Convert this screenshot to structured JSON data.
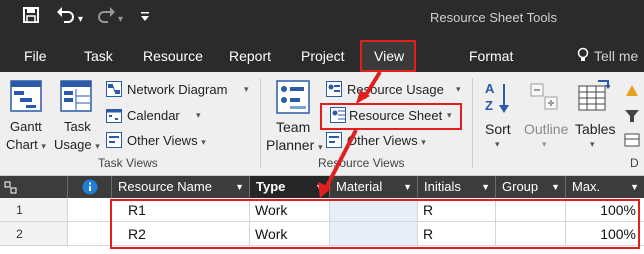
{
  "qat": {
    "save_icon": "save-icon",
    "undo_icon": "undo-icon",
    "redo_icon": "redo-icon",
    "customize_icon": "customize-icon"
  },
  "contextual_tab_label": "Resource Sheet Tools",
  "tabs": [
    {
      "label": "File"
    },
    {
      "label": "Task"
    },
    {
      "label": "Resource"
    },
    {
      "label": "Report"
    },
    {
      "label": "Project"
    },
    {
      "label": "View"
    },
    {
      "label": "Format"
    }
  ],
  "tell_me": "Tell me",
  "ribbon": {
    "task_views": {
      "gantt_l1": "Gantt",
      "gantt_l2": "Chart",
      "usage_l1": "Task",
      "usage_l2": "Usage",
      "network": "Network Diagram",
      "calendar": "Calendar",
      "other": "Other Views",
      "group_label": "Task Views"
    },
    "resource_views": {
      "team_l1": "Team",
      "team_l2": "Planner",
      "usage": "Resource Usage",
      "sheet": "Resource Sheet",
      "other": "Other Views",
      "group_label": "Resource Views"
    },
    "data": {
      "sort": "Sort",
      "outline": "Outline",
      "tables": "Tables",
      "group_label_partial": "D"
    }
  },
  "columns": [
    "Resource Name",
    "Type",
    "Material",
    "Initials",
    "Group",
    "Max."
  ],
  "rows": [
    {
      "num": "1",
      "name": "R1",
      "type": "Work",
      "material": "",
      "initials": "R",
      "group": "",
      "max": "100%"
    },
    {
      "num": "2",
      "name": "R2",
      "type": "Work",
      "material": "",
      "initials": "R",
      "group": "",
      "max": "100%"
    }
  ],
  "colors": {
    "dark": "#2b2b2b",
    "accent_red": "#e02020",
    "ribbon_bg": "#efefef"
  }
}
